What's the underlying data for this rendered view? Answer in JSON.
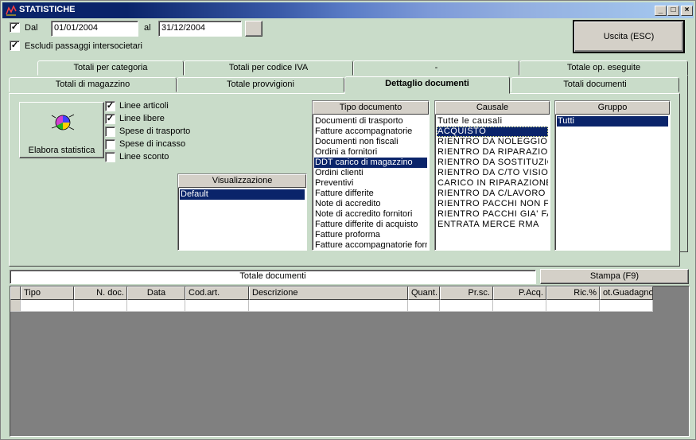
{
  "window": {
    "title": "STATISTICHE",
    "controls": {
      "minimize": "_",
      "maximize": "□",
      "close": "×"
    }
  },
  "filters": {
    "dal_label": "Dal",
    "dal_checked": true,
    "date_from": "01/01/2004",
    "al_label": "al",
    "date_to": "31/12/2004",
    "escludi_label": "Escludi passaggi intersocietari",
    "escludi_checked": true
  },
  "exit_button": "Uscita (ESC)",
  "tabs_row1": [
    {
      "label": "Totali per categoria"
    },
    {
      "label": "Totali per codice IVA"
    },
    {
      "label": "-"
    },
    {
      "label": "Totale op. eseguite"
    }
  ],
  "tabs_row2": [
    {
      "label": "Totali di magazzino"
    },
    {
      "label": "Totale provvigioni"
    },
    {
      "label": "Dettaglio documenti",
      "active": true
    },
    {
      "label": "Totali documenti"
    }
  ],
  "elabora_button": "Elabora statistica",
  "options": [
    {
      "label": "Linee articoli",
      "checked": true
    },
    {
      "label": "Linee libere",
      "checked": true
    },
    {
      "label": "Spese di trasporto",
      "checked": false
    },
    {
      "label": "Spese di incasso",
      "checked": false
    },
    {
      "label": "Linee sconto",
      "checked": false
    }
  ],
  "visualizzazione": {
    "header": "Visualizzazione",
    "items": [
      "Default"
    ],
    "selected": 0
  },
  "tipo_documento": {
    "header": "Tipo documento",
    "items": [
      "Documenti di trasporto",
      "Fatture accompagnatorie",
      "Documenti non fiscali",
      "Ordini a fornitori",
      "DDT carico di magazzino",
      "Ordini clienti",
      "Preventivi",
      "Fatture differite",
      "Note di accredito",
      "Note di accredito fornitori",
      "Fatture differite di acquisto",
      "Fatture proforma",
      "Fatture accompagnatorie forni"
    ],
    "selected": 4
  },
  "causale": {
    "header": "Causale",
    "items": [
      "Tutte le causali",
      "ACQUISTO",
      "RIENTRO DA NOLEGGIO",
      "RIENTRO DA RIPARAZIONE",
      "RIENTRO DA SOSTITUZIONE",
      "RIENTRO DA C/TO VISIONE",
      "CARICO IN RIPARAZIONE",
      "RIENTRO DA C/LAVORO",
      "RIENTRO PACCHI NON FAT",
      "RIENTRO PACCHI GIA' FATT",
      "ENTRATA MERCE RMA"
    ],
    "selected": 1
  },
  "gruppo": {
    "header": "Gruppo",
    "items": [
      "Tutti"
    ],
    "selected": 0
  },
  "totale_documenti_label": "Totale documenti",
  "stampa_button": "Stampa (F9)",
  "table": {
    "columns": [
      "Tipo",
      "N. doc.",
      "Data",
      "Cod.art.",
      "Descrizione",
      "Quant.",
      "Pr.sc.",
      "P.Acq.",
      "Ric.%",
      "ot.Guadagno"
    ]
  },
  "colors": {
    "window_bg": "#c9dcc9",
    "selection": "#0a246a",
    "grid_bg": "#808080"
  },
  "icons": {
    "app": "chart-app-icon",
    "elabora": "pie-chart-icon"
  }
}
